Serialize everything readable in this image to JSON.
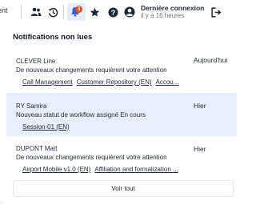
{
  "topbar": {
    "cut_label": "ent",
    "notification_count": "3",
    "last_connection_label": "Dernière connexion",
    "last_connection_value": "il y a 16 heures"
  },
  "panel": {
    "title": "Notifications non lues",
    "notifications": [
      {
        "name": "CLEVER Line",
        "message": "De nouveaux changements requièrent votre attention",
        "date": "Aujourd'hui",
        "links": [
          "Call Management",
          "Customer Repository (EN)",
          "Accou..."
        ]
      },
      {
        "name": "RY Samira",
        "message": "Nouveau statut de workflow assigné En cours",
        "date": "Hier",
        "links": [
          "Session-01 (EN)"
        ]
      },
      {
        "name": "DUPONT Matt",
        "message": "De nouveaux changements requièrent votre attention",
        "date": "Hier",
        "links": [
          "Airport Mobile v1.0 (EN)",
          "Affiliation and formalization ..."
        ]
      }
    ],
    "view_all_label": "Voir tout"
  },
  "colors": {
    "highlight": "#e8eefb",
    "badge": "#e8491d",
    "bell_bg": "#e8edfb"
  }
}
